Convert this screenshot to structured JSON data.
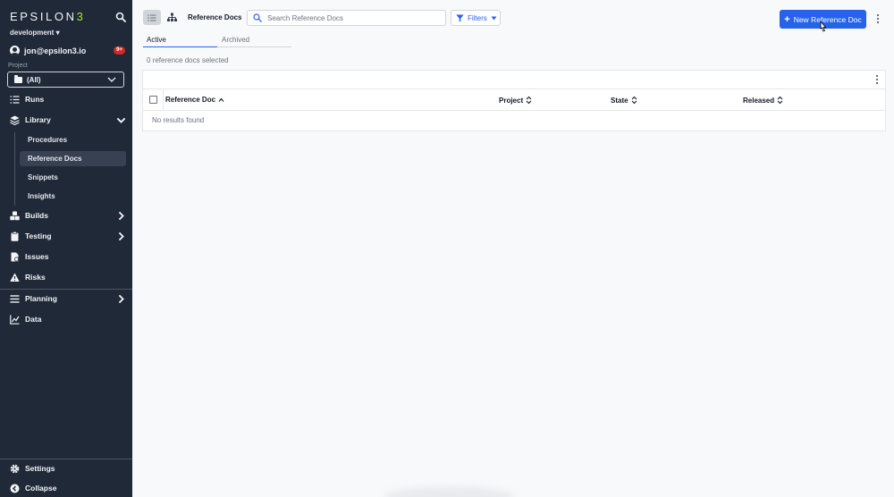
{
  "sidebar": {
    "logo_text": "EPSILON",
    "logo_accent": "3",
    "environment": "development",
    "user_email": "jon@epsilon3.io",
    "notifications_badge": "9+",
    "project_label": "Project",
    "project_value": "(All)",
    "nav": {
      "runs": "Runs",
      "library": "Library",
      "builds": "Builds",
      "testing": "Testing",
      "issues": "Issues",
      "risks": "Risks",
      "planning": "Planning",
      "data": "Data",
      "settings": "Settings",
      "collapse": "Collapse"
    },
    "library_sub": {
      "procedures": "Procedures",
      "reference_docs": "Reference Docs",
      "snippets": "Snippets",
      "insights": "Insights"
    }
  },
  "header": {
    "breadcrumb": "Reference Docs",
    "search_placeholder": "Search Reference Docs",
    "filters_label": "Filters",
    "new_button_label": "New Reference Doc"
  },
  "tabs": {
    "active": "Active",
    "archived": "Archived"
  },
  "selection_status": "0 reference docs selected",
  "table": {
    "columns": {
      "reference_doc": "Reference Doc",
      "project": "Project",
      "state": "State",
      "released": "Released"
    },
    "empty_message": "No results found"
  },
  "colors": {
    "sidebar_bg": "#1f2937",
    "accent": "#2563eb",
    "logo_accent": "#a3e635",
    "badge": "#dc2626"
  }
}
